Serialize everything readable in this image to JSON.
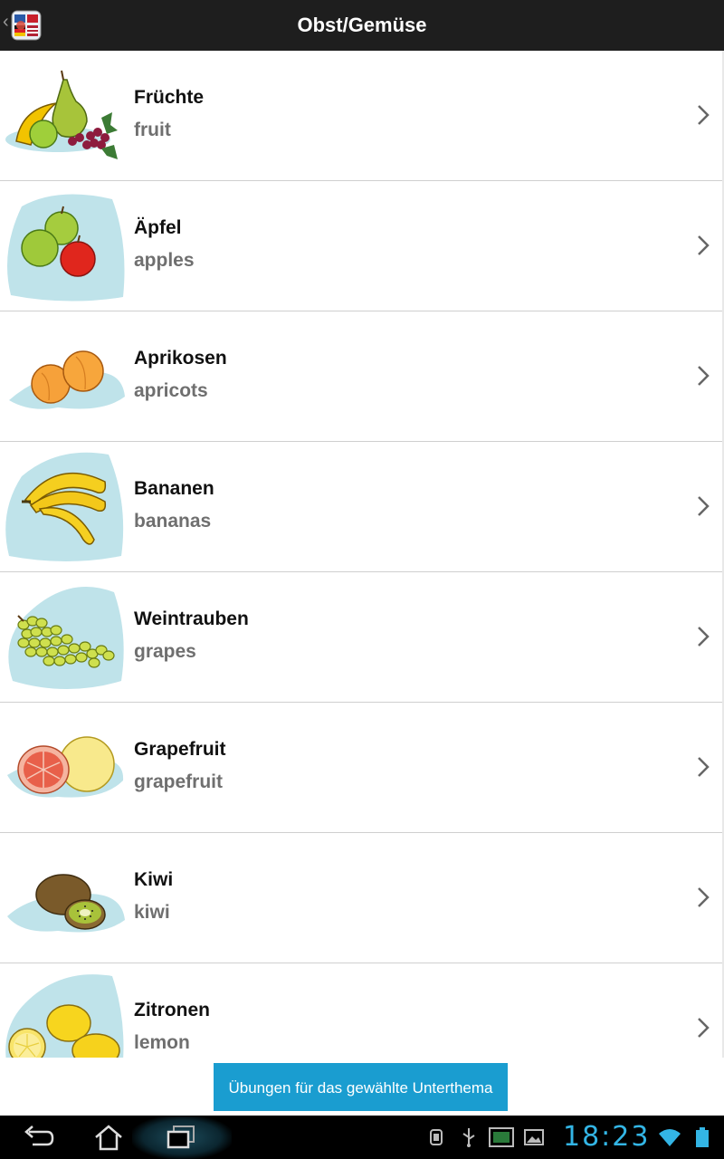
{
  "header": {
    "title": "Obst/Gemüse",
    "back_icon": "chevron-left-icon",
    "app_icon": "flags-app-icon"
  },
  "items": [
    {
      "de": "Früchte",
      "en": "fruit",
      "icon": "fruit-mix-image"
    },
    {
      "de": "Äpfel",
      "en": "apples",
      "icon": "apples-image"
    },
    {
      "de": "Aprikosen",
      "en": "apricots",
      "icon": "apricots-image"
    },
    {
      "de": "Bananen",
      "en": "bananas",
      "icon": "bananas-image"
    },
    {
      "de": "Weintrauben",
      "en": "grapes",
      "icon": "grapes-image"
    },
    {
      "de": "Grapefruit",
      "en": "grapefruit",
      "icon": "grapefruit-image"
    },
    {
      "de": "Kiwi",
      "en": "kiwi",
      "icon": "kiwi-image"
    },
    {
      "de": "Zitronen",
      "en": "lemon",
      "icon": "lemons-image"
    }
  ],
  "exercise_button": "Übungen für das gewählte Unterthema",
  "system_bar": {
    "time": "18:23",
    "accent_color": "#33b5e5",
    "icons": [
      "back-icon",
      "home-icon",
      "recent-apps-icon",
      "debug-icon",
      "usb-icon",
      "screenshot-icon",
      "gallery-icon",
      "wifi-icon",
      "battery-icon"
    ]
  },
  "colors": {
    "action_bar": "#1e1e1e",
    "button": "#1a9dd0",
    "secondary_text": "#6f6f6f",
    "blob": "#bfe3ea"
  }
}
